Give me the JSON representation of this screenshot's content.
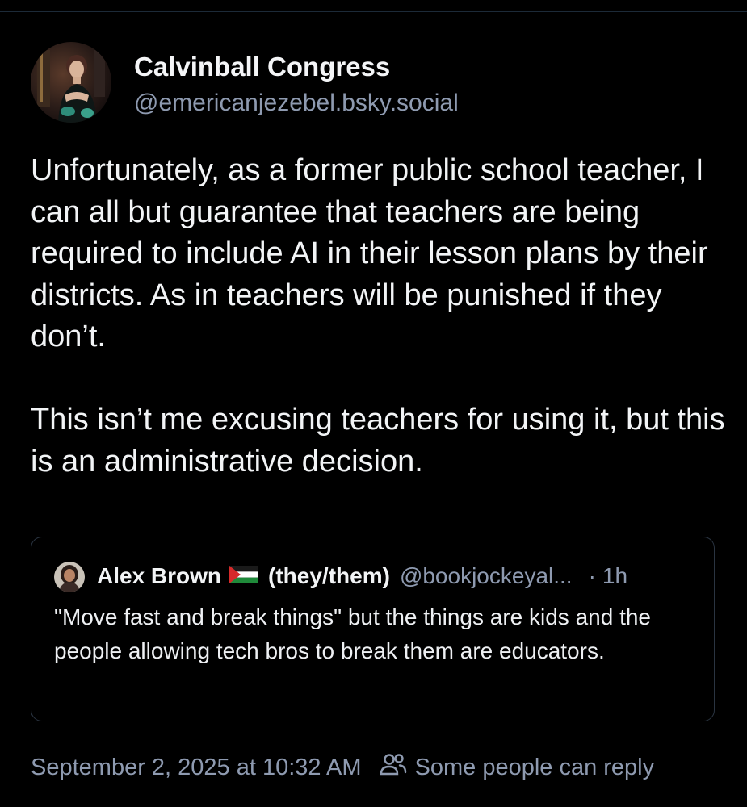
{
  "post": {
    "author_name": "Calvinball Congress",
    "author_handle": "@emericanjezebel.bsky.social",
    "avatar_icon": "user-avatar-photo",
    "body_paragraphs": [
      "Unfortunately, as a former public school teacher, I can all but guarantee that teachers are being required to include AI in their lesson plans by their districts. As in teachers will be punished if they don’t.",
      "This isn’t me excusing teachers for using it, but this is an administrative decision."
    ],
    "timestamp": "September 2, 2025 at 10:32 AM",
    "reply_setting": "Some people can reply",
    "reply_icon": "people-icon"
  },
  "quote": {
    "author_name": "Alex Brown",
    "flag_icon": "palestine-flag-icon",
    "pronouns": "(they/them)",
    "handle": "@bookjockeyal...",
    "separator": "·",
    "time": "1h",
    "text": "\"Move fast and break things\" but the things are kids and the people allowing tech bros to break them are educators."
  },
  "colors": {
    "background": "#000000",
    "primary_text": "#f2f4f6",
    "secondary_text": "#8e9ab0",
    "border": "#2a3441"
  }
}
